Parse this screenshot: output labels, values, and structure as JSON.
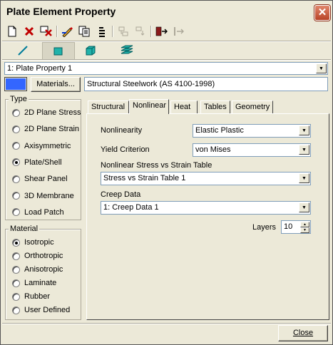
{
  "window": {
    "title": "Plate Element Property",
    "close_glyph": "✕"
  },
  "toolbar": {
    "buttons": [
      {
        "name": "new-icon",
        "enabled": true
      },
      {
        "name": "delete-icon",
        "enabled": true
      },
      {
        "name": "delete-unused-icon",
        "enabled": true
      },
      {
        "name": "edit-icon",
        "enabled": true
      },
      {
        "name": "copy-icon",
        "enabled": true
      },
      {
        "name": "renumber-icon",
        "enabled": true
      },
      {
        "name": "import-disabled-icon",
        "enabled": false
      },
      {
        "name": "export-disabled-icon",
        "enabled": false
      },
      {
        "name": "apply-icon",
        "enabled": true
      },
      {
        "name": "apply-disabled-icon",
        "enabled": false
      }
    ]
  },
  "element_tabs": [
    {
      "name": "beam-element-icon",
      "selected": false
    },
    {
      "name": "plate-element-icon",
      "selected": true
    },
    {
      "name": "brick-element-icon",
      "selected": false
    },
    {
      "name": "multi-layer-element-icon",
      "selected": false
    }
  ],
  "property_select": {
    "value": "1: Plate Property 1"
  },
  "color_swatch": "#3366ff",
  "materials_button": {
    "label": "Materials..."
  },
  "material_name": {
    "value": "Structural Steelwork (AS 4100-1998)"
  },
  "type_group": {
    "label": "Type",
    "options": [
      {
        "label": "2D Plane Stress",
        "selected": false
      },
      {
        "label": "2D Plane Strain",
        "selected": false
      },
      {
        "label": "Axisymmetric",
        "selected": false
      },
      {
        "label": "Plate/Shell",
        "selected": true
      },
      {
        "label": "Shear Panel",
        "selected": false
      },
      {
        "label": "3D Membrane",
        "selected": false
      },
      {
        "label": "Load Patch",
        "selected": false
      }
    ]
  },
  "material_group": {
    "label": "Material",
    "options": [
      {
        "label": "Isotropic",
        "selected": true
      },
      {
        "label": "Orthotropic",
        "selected": false
      },
      {
        "label": "Anisotropic",
        "selected": false
      },
      {
        "label": "Laminate",
        "selected": false
      },
      {
        "label": "Rubber",
        "selected": false
      },
      {
        "label": "User Defined",
        "selected": false
      }
    ]
  },
  "tabs": [
    {
      "label": "Structural",
      "active": false
    },
    {
      "label": "Nonlinear",
      "active": true
    },
    {
      "label": "Heat",
      "active": false
    },
    {
      "label": "Tables",
      "active": false
    },
    {
      "label": "Geometry",
      "active": false
    }
  ],
  "nonlinear": {
    "nonlinearity_label": "Nonlinearity",
    "nonlinearity_value": "Elastic Plastic",
    "yield_label": "Yield Criterion",
    "yield_value": "von Mises",
    "stress_strain_label": "Nonlinear Stress vs Strain Table",
    "stress_strain_value": "Stress vs Strain Table 1",
    "creep_label": "Creep Data",
    "creep_value": "1: Creep Data 1",
    "layers_label": "Layers",
    "layers_value": "10"
  },
  "close_button": {
    "label": "Close"
  }
}
